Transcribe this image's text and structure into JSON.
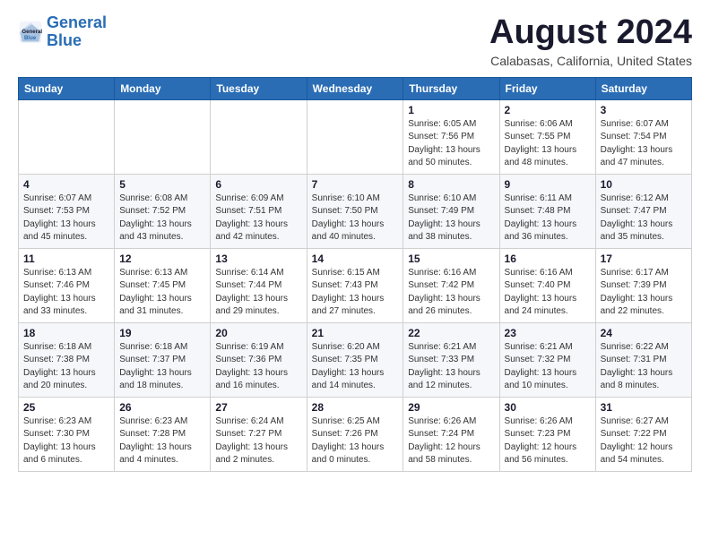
{
  "logo": {
    "line1": "General",
    "line2": "Blue"
  },
  "title": "August 2024",
  "subtitle": "Calabasas, California, United States",
  "weekdays": [
    "Sunday",
    "Monday",
    "Tuesday",
    "Wednesday",
    "Thursday",
    "Friday",
    "Saturday"
  ],
  "weeks": [
    [
      {
        "day": "",
        "info": ""
      },
      {
        "day": "",
        "info": ""
      },
      {
        "day": "",
        "info": ""
      },
      {
        "day": "",
        "info": ""
      },
      {
        "day": "1",
        "info": "Sunrise: 6:05 AM\nSunset: 7:56 PM\nDaylight: 13 hours\nand 50 minutes."
      },
      {
        "day": "2",
        "info": "Sunrise: 6:06 AM\nSunset: 7:55 PM\nDaylight: 13 hours\nand 48 minutes."
      },
      {
        "day": "3",
        "info": "Sunrise: 6:07 AM\nSunset: 7:54 PM\nDaylight: 13 hours\nand 47 minutes."
      }
    ],
    [
      {
        "day": "4",
        "info": "Sunrise: 6:07 AM\nSunset: 7:53 PM\nDaylight: 13 hours\nand 45 minutes."
      },
      {
        "day": "5",
        "info": "Sunrise: 6:08 AM\nSunset: 7:52 PM\nDaylight: 13 hours\nand 43 minutes."
      },
      {
        "day": "6",
        "info": "Sunrise: 6:09 AM\nSunset: 7:51 PM\nDaylight: 13 hours\nand 42 minutes."
      },
      {
        "day": "7",
        "info": "Sunrise: 6:10 AM\nSunset: 7:50 PM\nDaylight: 13 hours\nand 40 minutes."
      },
      {
        "day": "8",
        "info": "Sunrise: 6:10 AM\nSunset: 7:49 PM\nDaylight: 13 hours\nand 38 minutes."
      },
      {
        "day": "9",
        "info": "Sunrise: 6:11 AM\nSunset: 7:48 PM\nDaylight: 13 hours\nand 36 minutes."
      },
      {
        "day": "10",
        "info": "Sunrise: 6:12 AM\nSunset: 7:47 PM\nDaylight: 13 hours\nand 35 minutes."
      }
    ],
    [
      {
        "day": "11",
        "info": "Sunrise: 6:13 AM\nSunset: 7:46 PM\nDaylight: 13 hours\nand 33 minutes."
      },
      {
        "day": "12",
        "info": "Sunrise: 6:13 AM\nSunset: 7:45 PM\nDaylight: 13 hours\nand 31 minutes."
      },
      {
        "day": "13",
        "info": "Sunrise: 6:14 AM\nSunset: 7:44 PM\nDaylight: 13 hours\nand 29 minutes."
      },
      {
        "day": "14",
        "info": "Sunrise: 6:15 AM\nSunset: 7:43 PM\nDaylight: 13 hours\nand 27 minutes."
      },
      {
        "day": "15",
        "info": "Sunrise: 6:16 AM\nSunset: 7:42 PM\nDaylight: 13 hours\nand 26 minutes."
      },
      {
        "day": "16",
        "info": "Sunrise: 6:16 AM\nSunset: 7:40 PM\nDaylight: 13 hours\nand 24 minutes."
      },
      {
        "day": "17",
        "info": "Sunrise: 6:17 AM\nSunset: 7:39 PM\nDaylight: 13 hours\nand 22 minutes."
      }
    ],
    [
      {
        "day": "18",
        "info": "Sunrise: 6:18 AM\nSunset: 7:38 PM\nDaylight: 13 hours\nand 20 minutes."
      },
      {
        "day": "19",
        "info": "Sunrise: 6:18 AM\nSunset: 7:37 PM\nDaylight: 13 hours\nand 18 minutes."
      },
      {
        "day": "20",
        "info": "Sunrise: 6:19 AM\nSunset: 7:36 PM\nDaylight: 13 hours\nand 16 minutes."
      },
      {
        "day": "21",
        "info": "Sunrise: 6:20 AM\nSunset: 7:35 PM\nDaylight: 13 hours\nand 14 minutes."
      },
      {
        "day": "22",
        "info": "Sunrise: 6:21 AM\nSunset: 7:33 PM\nDaylight: 13 hours\nand 12 minutes."
      },
      {
        "day": "23",
        "info": "Sunrise: 6:21 AM\nSunset: 7:32 PM\nDaylight: 13 hours\nand 10 minutes."
      },
      {
        "day": "24",
        "info": "Sunrise: 6:22 AM\nSunset: 7:31 PM\nDaylight: 13 hours\nand 8 minutes."
      }
    ],
    [
      {
        "day": "25",
        "info": "Sunrise: 6:23 AM\nSunset: 7:30 PM\nDaylight: 13 hours\nand 6 minutes."
      },
      {
        "day": "26",
        "info": "Sunrise: 6:23 AM\nSunset: 7:28 PM\nDaylight: 13 hours\nand 4 minutes."
      },
      {
        "day": "27",
        "info": "Sunrise: 6:24 AM\nSunset: 7:27 PM\nDaylight: 13 hours\nand 2 minutes."
      },
      {
        "day": "28",
        "info": "Sunrise: 6:25 AM\nSunset: 7:26 PM\nDaylight: 13 hours\nand 0 minutes."
      },
      {
        "day": "29",
        "info": "Sunrise: 6:26 AM\nSunset: 7:24 PM\nDaylight: 12 hours\nand 58 minutes."
      },
      {
        "day": "30",
        "info": "Sunrise: 6:26 AM\nSunset: 7:23 PM\nDaylight: 12 hours\nand 56 minutes."
      },
      {
        "day": "31",
        "info": "Sunrise: 6:27 AM\nSunset: 7:22 PM\nDaylight: 12 hours\nand 54 minutes."
      }
    ]
  ]
}
